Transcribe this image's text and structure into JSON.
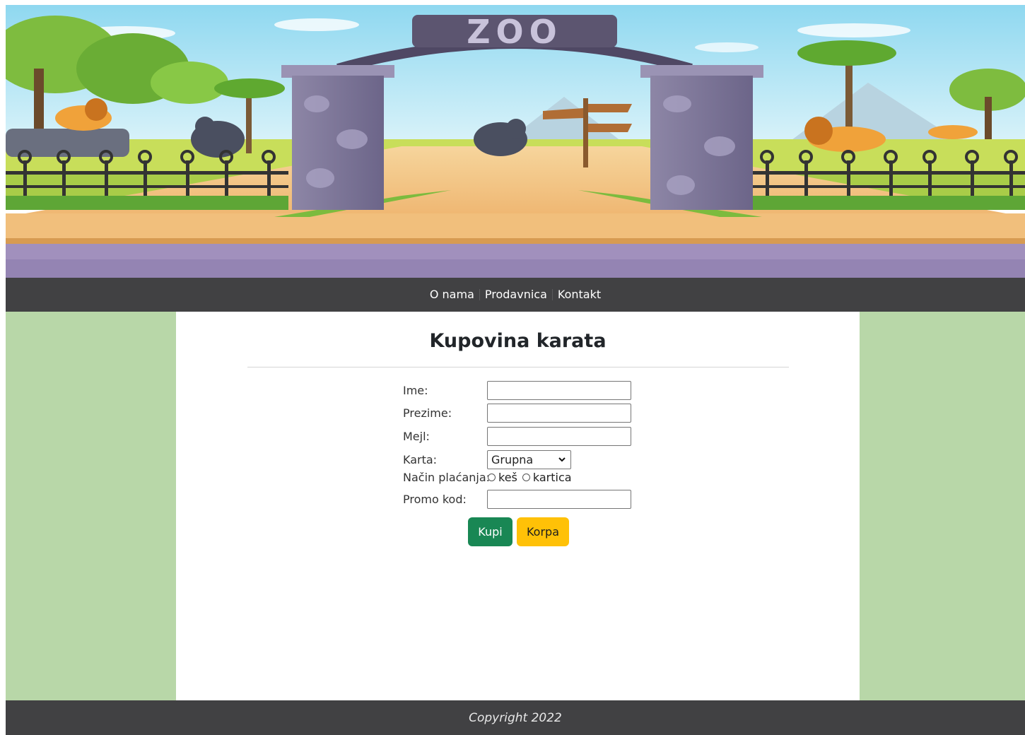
{
  "banner": {
    "sign_text": "ZOO"
  },
  "nav": {
    "items": [
      {
        "label": "O nama"
      },
      {
        "label": "Prodavnica"
      },
      {
        "label": "Kontakt"
      }
    ]
  },
  "main": {
    "title": "Kupovina karata"
  },
  "form": {
    "ime_label": "Ime:",
    "ime_value": "",
    "prezime_label": "Prezime:",
    "prezime_value": "",
    "mejl_label": "Mejl:",
    "mejl_value": "",
    "karta_label": "Karta:",
    "karta_selected": "Grupna",
    "nacin_label": "Način plaćanja:",
    "nacin_options": [
      "keš",
      "kartica"
    ],
    "promo_label": "Promo kod:",
    "promo_value": "",
    "kupi_label": "Kupi",
    "korpa_label": "Korpa"
  },
  "footer": {
    "copyright": "Copyright 2022"
  },
  "colors": {
    "nav_bg": "#414143",
    "side_bg": "#b8d7a8",
    "kupi_btn": "#198754",
    "korpa_btn": "#ffc107"
  }
}
